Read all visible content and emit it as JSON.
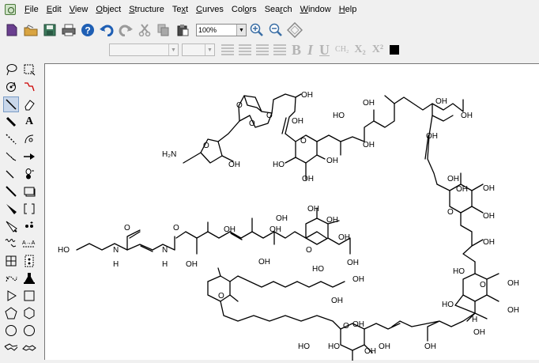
{
  "menu": {
    "items": [
      {
        "key": "F",
        "rest": "ile"
      },
      {
        "key": "E",
        "rest": "dit"
      },
      {
        "key": "V",
        "rest": "iew"
      },
      {
        "key": "O",
        "rest": "bject"
      },
      {
        "key": "S",
        "rest": "tructure"
      },
      {
        "pre": "Te",
        "key": "x",
        "rest": "t"
      },
      {
        "key": "C",
        "rest": "urves"
      },
      {
        "pre": "Col",
        "key": "o",
        "rest": "rs"
      },
      {
        "pre": "Sea",
        "key": "r",
        "rest": "ch"
      },
      {
        "key": "W",
        "rest": "indow"
      },
      {
        "key": "H",
        "rest": "elp"
      }
    ]
  },
  "toolbar": {
    "zoom_value": "100%"
  },
  "format_toolbar": {
    "bold": "B",
    "italic": "I",
    "underline": "U",
    "ch2": "CH₂",
    "subscript": "X₂",
    "superscript": "X²"
  },
  "palette": {
    "text_tool": "A"
  },
  "molecule": {
    "labels": {
      "h2n": "H₂N",
      "o": "O",
      "oh": "OH",
      "ho": "HO",
      "n": "N",
      "h": "H"
    }
  }
}
